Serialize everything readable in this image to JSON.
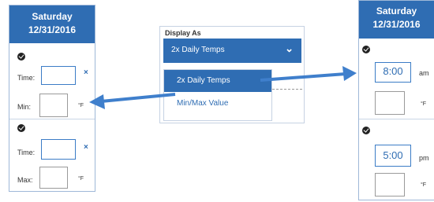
{
  "left_panel": {
    "day": "Saturday",
    "date": "12/31/2016",
    "time_label_1": "Time:",
    "min_label": "Min:",
    "min_unit": "°F",
    "time_label_2": "Time:",
    "max_label": "Max:",
    "max_unit": "°F",
    "clear_1": "×",
    "clear_2": "×"
  },
  "dropdown": {
    "label": "Display As",
    "selected": "2x Daily Temps",
    "chevron": "⌄",
    "options": [
      "2x Daily Temps",
      "Min/Max Value"
    ]
  },
  "right_panel": {
    "day": "Saturday",
    "date": "12/31/2016",
    "time_1": "8:00",
    "ampm_1": "am",
    "unit_1": "°F",
    "time_2": "5:00",
    "ampm_2": "pm",
    "unit_2": "°F"
  },
  "icons": {
    "check": "check-circle-icon",
    "clear": "close-icon",
    "chevron": "chevron-down-icon",
    "arrow": "arrow-icon"
  },
  "colors": {
    "accent": "#2f6db3",
    "arrow": "#3f7fcc"
  }
}
